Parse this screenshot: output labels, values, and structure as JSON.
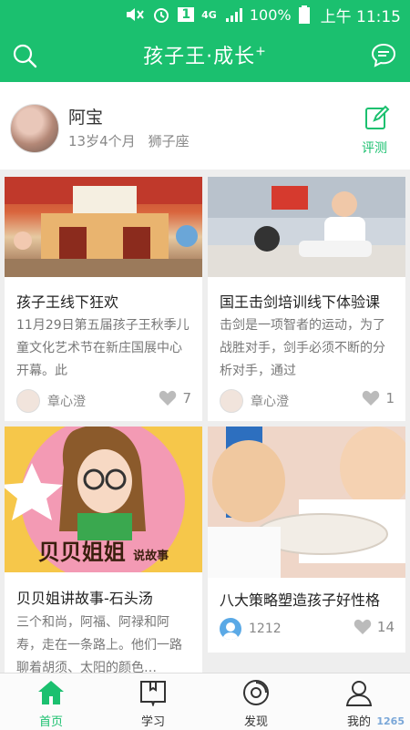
{
  "status_bar": {
    "network": "4G",
    "sim": "1",
    "battery": "100%",
    "time": "上午 11:15"
  },
  "header": {
    "title": "孩子王·成长",
    "title_sup": "+"
  },
  "profile": {
    "name": "阿宝",
    "age": "13岁4个月",
    "zodiac": "狮子座",
    "action_label": "评测"
  },
  "cards": [
    {
      "title": "孩子王线下狂欢",
      "desc": "11月29日第五届孩子王秋季儿童文化艺术节在新庄国展中心开幕。此",
      "author": "章心澄",
      "likes": "7"
    },
    {
      "title": "国王击剑培训线下体验课",
      "desc": "击剑是一项智者的运动，为了战胜对手，剑手必须不断的分析对手，通过",
      "author": "章心澄",
      "likes": "1"
    },
    {
      "title": "贝贝姐讲故事-石头汤",
      "desc": "三个和尚，阿福、阿禄和阿寿，走在一条路上。他们一路聊着胡须、太阳的颜色…",
      "image_text_main": "贝贝姐姐",
      "image_text_sub": "说故事"
    },
    {
      "title": "八大策略塑造孩子好性格",
      "author": "1212",
      "likes": "14"
    }
  ],
  "nav": [
    {
      "label": "首页",
      "icon": "home-icon",
      "active": true
    },
    {
      "label": "学习",
      "icon": "book-icon",
      "active": false
    },
    {
      "label": "发现",
      "icon": "discover-icon",
      "active": false
    },
    {
      "label": "我的",
      "icon": "profile-icon",
      "active": false
    }
  ],
  "watermark": "1265",
  "colors": {
    "brand": "#1bc06f"
  }
}
